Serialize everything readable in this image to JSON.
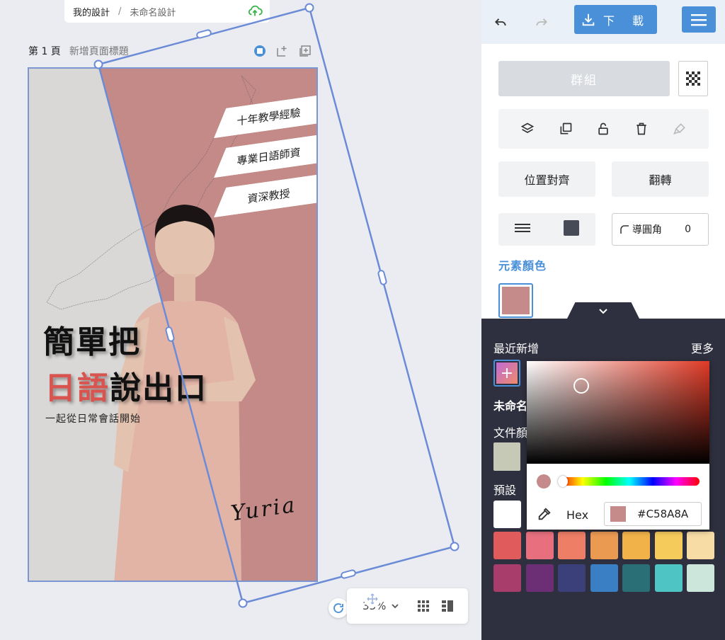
{
  "breadcrumb": {
    "root": "我的設計",
    "separator": "/",
    "current": "未命名設計"
  },
  "page": {
    "number": "第 1 頁",
    "title_placeholder": "新增頁面標題"
  },
  "design": {
    "banners": [
      "十年教學經驗",
      "專業日語師資",
      "資深教授"
    ],
    "headline_line1": "簡單把",
    "headline_line2_accent": "日語",
    "headline_line2_rest": "說出口",
    "subline": "一起從日常會話開始",
    "signature": "Yuria",
    "colors": {
      "pink_bg": "#c48a88",
      "left_bg": "#d9d8d6",
      "accent": "#d9534f"
    }
  },
  "zoom": {
    "value": "33%"
  },
  "toolbar": {
    "download_label": "下 載"
  },
  "panel": {
    "group_label": "群組",
    "align_label": "位置對齊",
    "flip_label": "翻轉",
    "radius_label": "導圓角",
    "radius_value": "0",
    "element_color_title": "元素顏色",
    "element_color": "#C58A8A"
  },
  "colors_panel": {
    "recent_label": "最近新增",
    "more_label": "更多",
    "unnamed_label": "未命名",
    "doc_label": "文件顏",
    "preset_label": "預設",
    "hex_label": "Hex",
    "hex_value": "#C58A8A",
    "doc_color": "#c5c9b5",
    "presets_row1": [
      "#ffffff"
    ],
    "presets_row2": [
      "#e05c5c",
      "#e8707e",
      "#ee7e66",
      "#eb9a52",
      "#f2b24a",
      "#f5cc5c",
      "#f8dca6"
    ],
    "presets_row3": [
      "#a83c6a",
      "#6c2f76",
      "#3b3f7a",
      "#3a7fc4",
      "#2a6e76",
      "#4fc4c4",
      "#cce6dc"
    ]
  },
  "icons": [
    "cloud-upload-icon",
    "layers-icon",
    "duplicate-icon",
    "unlock-icon",
    "trash-icon",
    "brush-icon",
    "undo-icon",
    "redo-icon",
    "menu-icon",
    "download-icon",
    "eyedropper-icon"
  ]
}
